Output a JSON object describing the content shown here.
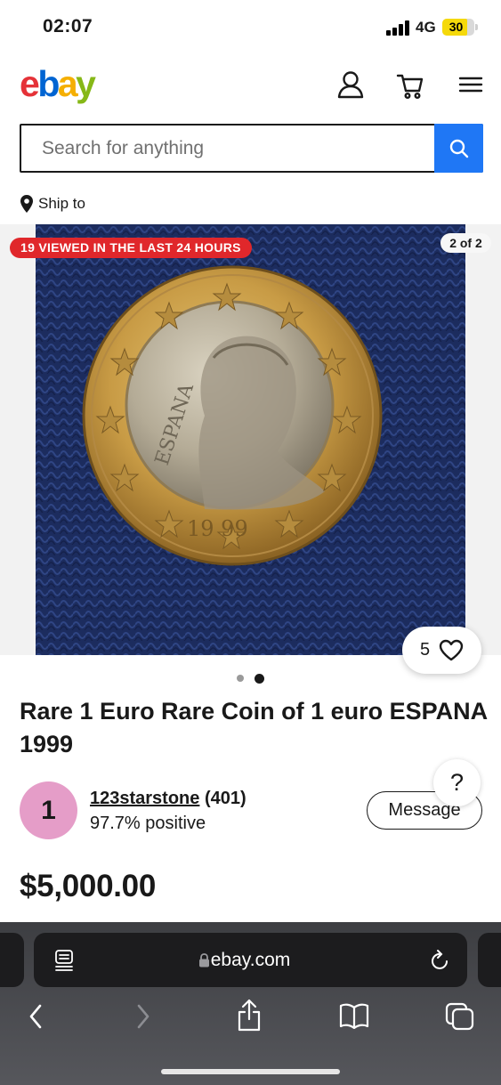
{
  "status_bar": {
    "time": "02:07",
    "network": "4G",
    "battery": "30",
    "battery_color": "#f5d90a"
  },
  "header": {
    "logo_letters": [
      "e",
      "b",
      "a",
      "y"
    ],
    "logo_colors": [
      "#e53238",
      "#0064d2",
      "#f5af02",
      "#86b817"
    ],
    "icons": [
      "account-icon",
      "cart-icon",
      "menu-icon"
    ]
  },
  "search": {
    "placeholder": "Search for anything",
    "button_icon": "search-icon",
    "button_color": "#1f77f5"
  },
  "ship_to": {
    "label": "Ship to",
    "icon": "location-pin-icon"
  },
  "gallery": {
    "viewed_badge": "19 VIEWED IN THE LAST 24 HOURS",
    "counter": "2 of 2",
    "watch_count": "5",
    "image_description": "gold coin on blue knit fabric",
    "coin_legend": "ESPANA",
    "coin_year": "19 99",
    "pages": 2,
    "active_page": 2
  },
  "item": {
    "title": "Rare 1 Euro Rare Coin of 1 euro ESPANA 1999",
    "price": "$5,000.00"
  },
  "seller": {
    "avatar_letter": "1",
    "avatar_color": "#e59dc8",
    "name": "123starstone",
    "score": "(401)",
    "positive": "97.7% positive",
    "message_button": "Message"
  },
  "help": {
    "label": "?"
  },
  "browser": {
    "url": "ebay.com",
    "icons": [
      "reader-icon",
      "lock-icon",
      "reload-icon",
      "back-icon",
      "forward-icon",
      "share-icon",
      "bookmarks-icon",
      "tabs-icon"
    ]
  }
}
